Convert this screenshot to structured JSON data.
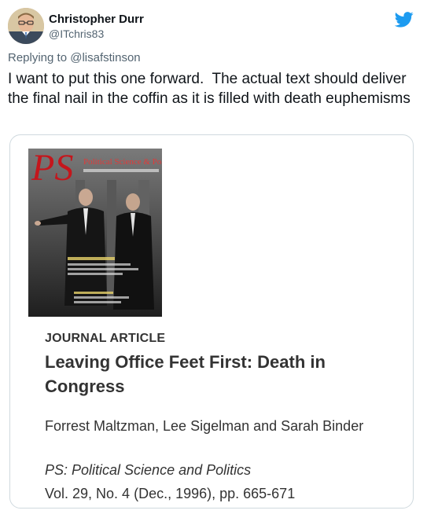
{
  "author": {
    "name": "Christopher Durr",
    "handle": "@ITchris83",
    "avatar_icon": "person-avatar-icon"
  },
  "platform_icon": "twitter-bird-icon",
  "reply": {
    "prefix": "Replying to ",
    "mention": "@lisafstinson"
  },
  "tweet": {
    "text": "I want to put this one forward.  The actual text should deliver the final nail in the coffin as it is filled with death euphemisms"
  },
  "card": {
    "cover": {
      "masthead_letters": "PS",
      "masthead_title": "Political Science & Politics"
    },
    "kicker": "JOURNAL ARTICLE",
    "title": "Leaving Office Feet First: Death in Congress",
    "authors": "Forrest Maltzman, Lee Sigelman and Sarah Binder",
    "journal": "PS: Political Science and Politics",
    "volume": "Vol. 29, No. 4 (Dec., 1996), pp. 665-671"
  },
  "colors": {
    "twitter_blue": "#1d9bf0",
    "secondary_text": "#536471",
    "card_border": "#cfd9de",
    "cover_red": "#c4161c"
  }
}
